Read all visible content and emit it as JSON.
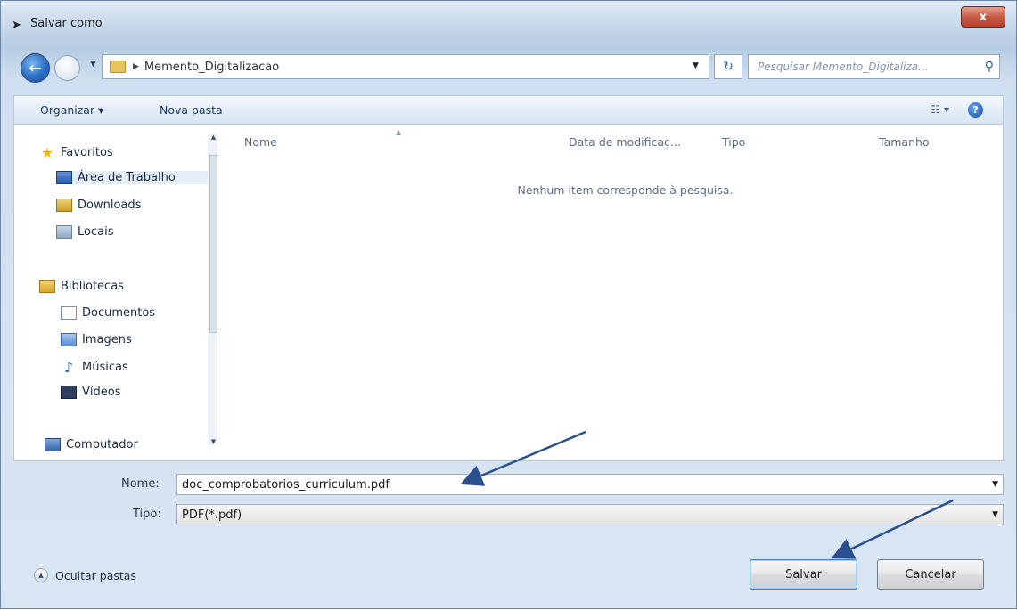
{
  "window": {
    "title": "Salvar como",
    "close_label": "x"
  },
  "address": {
    "breadcrumb": [
      "Memento_Digitalizacao"
    ],
    "search_placeholder": "Pesquisar Memento_Digitaliza..."
  },
  "toolbar": {
    "organize_label": "Organizar ▾",
    "new_folder_label": "Nova pasta"
  },
  "nav": {
    "favorites": "Favoritos",
    "desktop": "Área de Trabalho",
    "downloads": "Downloads",
    "places": "Locais",
    "libraries": "Bibliotecas",
    "documents": "Documentos",
    "images": "Imagens",
    "music": "Músicas",
    "videos": "Vídeos",
    "computer": "Computador"
  },
  "files": {
    "columns": {
      "name": "Nome",
      "date": "Data de modificaç...",
      "type": "Tipo",
      "size": "Tamanho"
    },
    "empty_message": "Nenhum item corresponde à pesquisa."
  },
  "form": {
    "name_label": "Nome:",
    "name_value": "doc_comprobatorios_curriculum.pdf",
    "type_label": "Tipo:",
    "type_value": "PDF(*.pdf)"
  },
  "footer": {
    "hide_folders_label": "Ocultar pastas",
    "save_label": "Salvar",
    "cancel_label": "Cancelar"
  },
  "colors": {
    "accent": "#2664b4",
    "annotation_arrow": "#2a4f8f"
  }
}
